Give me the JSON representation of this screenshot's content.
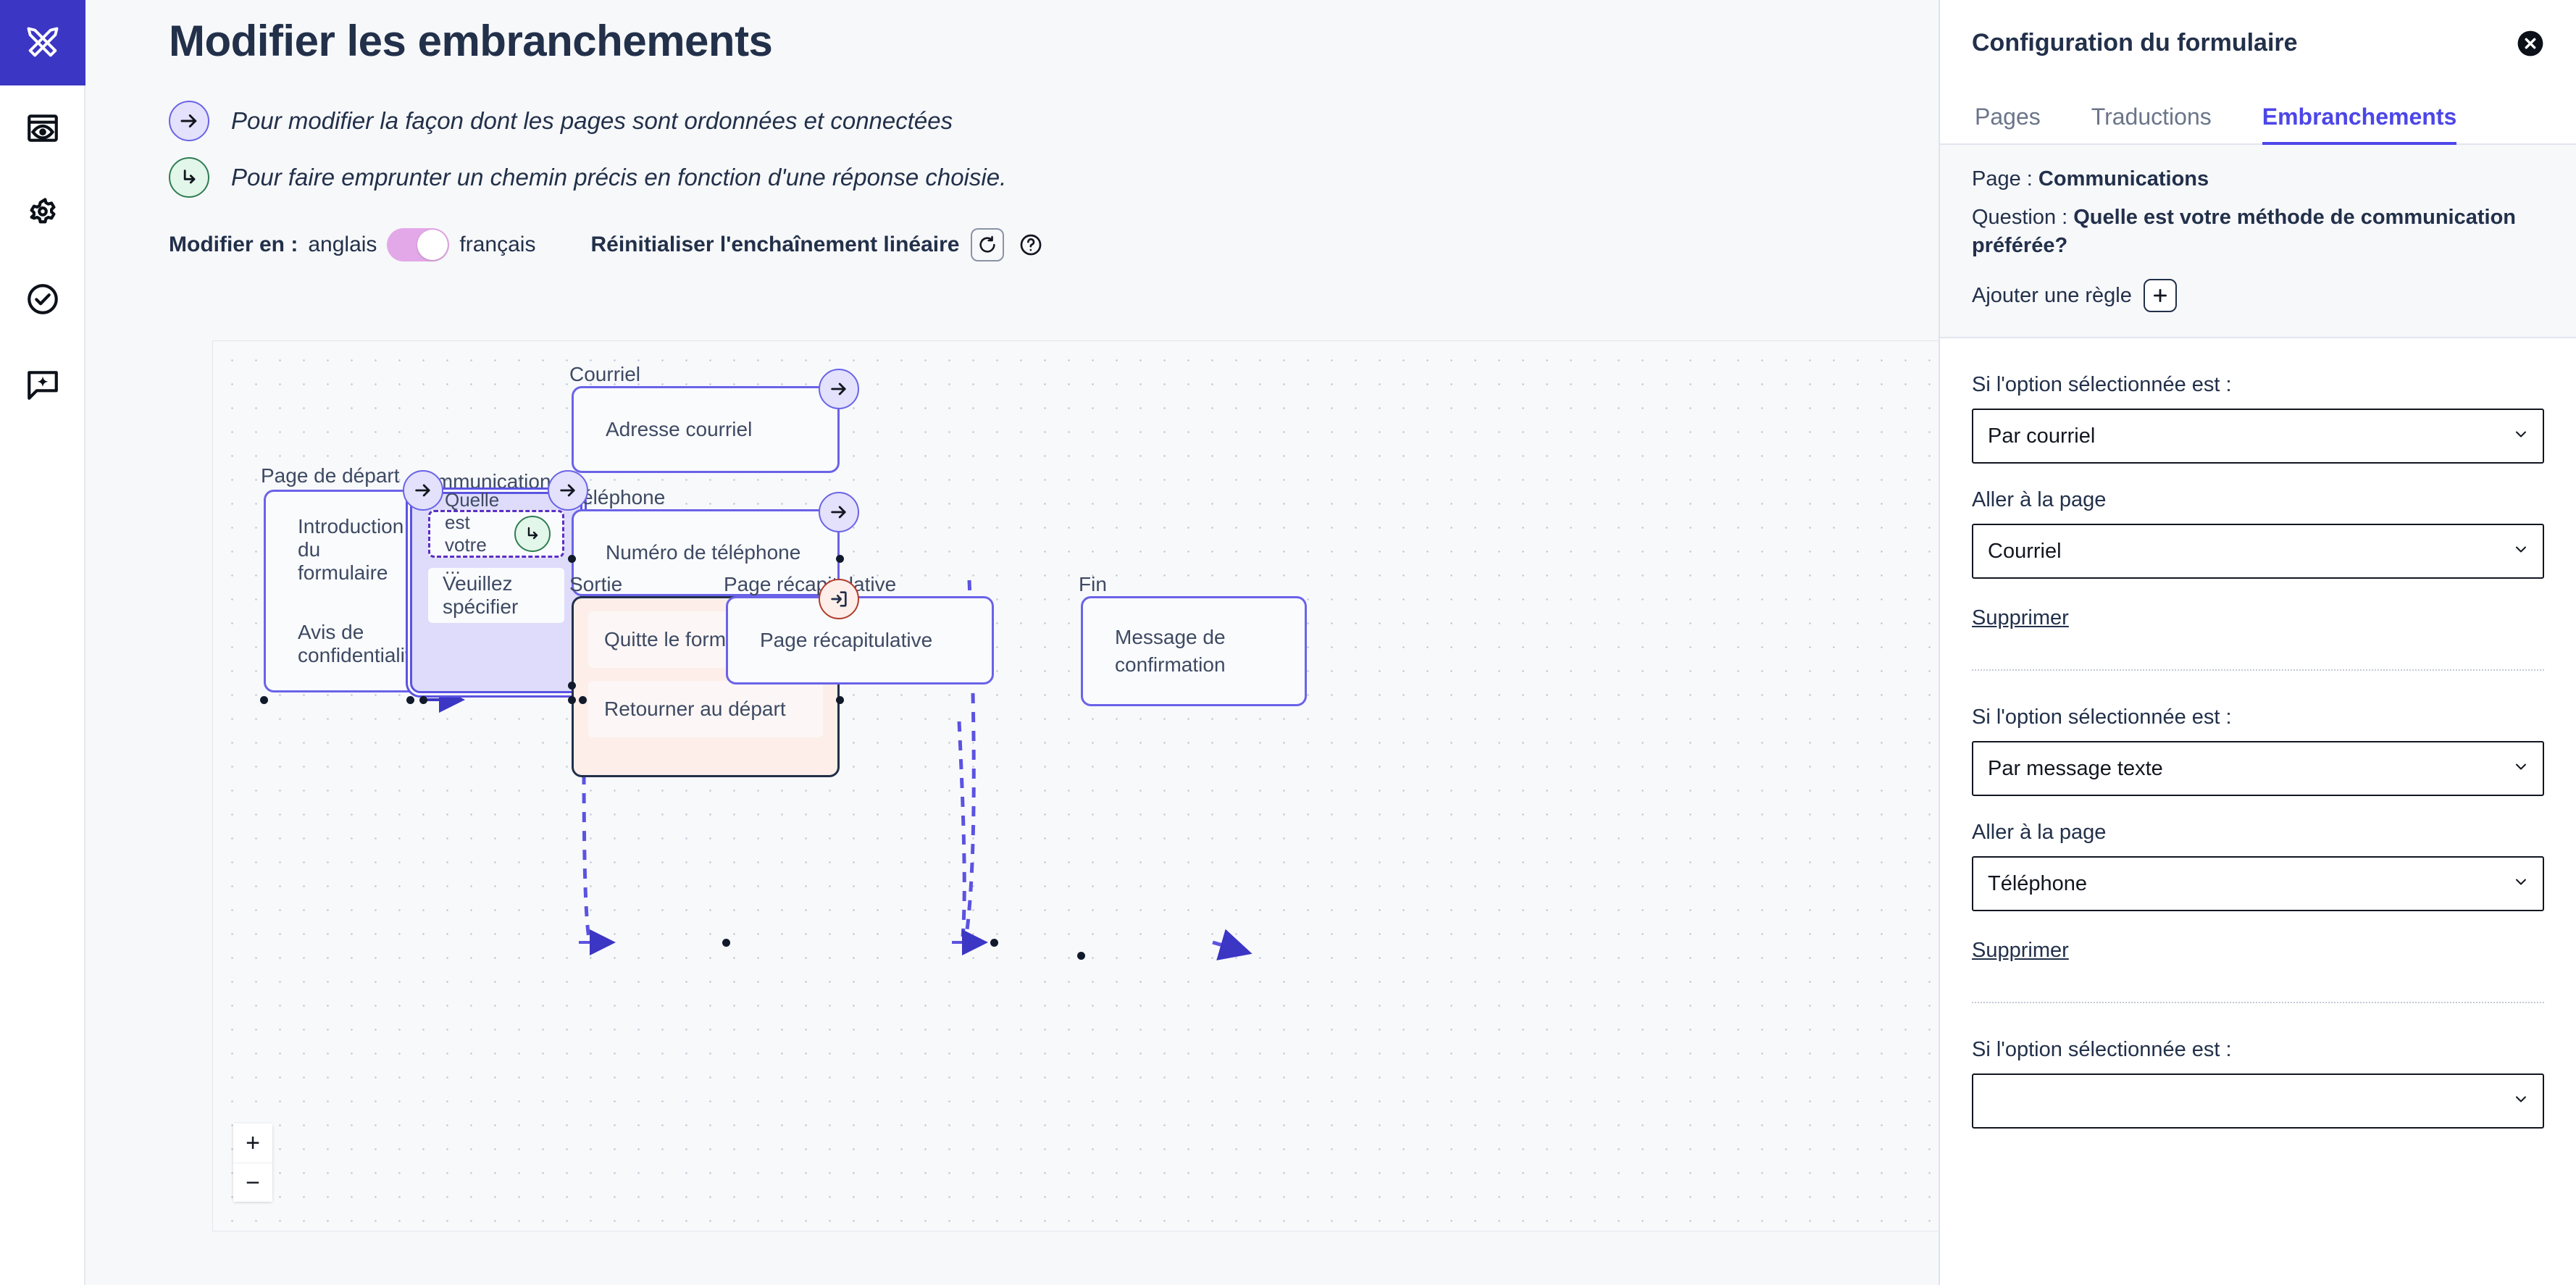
{
  "rail": {
    "items": [
      {
        "name": "design-tools-icon",
        "label": "Conception",
        "active": true
      },
      {
        "name": "preview-icon",
        "label": "Aperçu",
        "active": false
      },
      {
        "name": "gear-icon",
        "label": "Paramètres",
        "active": false
      },
      {
        "name": "check-circle-icon",
        "label": "Validation",
        "active": false
      },
      {
        "name": "feedback-sparkle-icon",
        "label": "Commentaires",
        "active": false
      }
    ]
  },
  "header": {
    "title": "Modifier les embranchements",
    "legend": [
      {
        "icon": "arrow-right-icon",
        "text": "Pour modifier la façon dont les pages sont ordonnées et connectées"
      },
      {
        "icon": "branch-arrow-icon",
        "text": "Pour faire emprunter un chemin précis en fonction d'une réponse choisie."
      }
    ],
    "controls": {
      "edit_in_label": "Modifier en :",
      "lang_left": "anglais",
      "lang_right": "français",
      "toggle_state": "français",
      "reset_label": "Réinitialiser l'enchaînement linéaire",
      "reset_icon": "reset-arrow-icon",
      "help_icon": "question-circle-icon"
    }
  },
  "canvas": {
    "zoom_in_label": "+",
    "zoom_out_label": "−",
    "nodes": [
      {
        "id": "start",
        "label": "Page de départ",
        "rows": [
          "Introduction du formulaire",
          "Avis de confidentialité"
        ]
      },
      {
        "id": "comm",
        "label": "Communications",
        "question": "Quelle est votre ...",
        "rows": [
          "Veuillez spécifier"
        ],
        "selected": true
      },
      {
        "id": "courriel",
        "label": "Courriel",
        "rows": [
          "Adresse courriel"
        ]
      },
      {
        "id": "tel",
        "label": "Téléphone",
        "rows": [
          "Numéro de téléphone"
        ]
      },
      {
        "id": "sortie",
        "label": "Sortie",
        "rows": [
          "Quitte le formulaire",
          "Retourner au départ"
        ],
        "exit": true
      },
      {
        "id": "recap",
        "label": "Page récapitulative",
        "rows": [
          "Page récapitulative"
        ]
      },
      {
        "id": "fin",
        "label": "Fin",
        "rows": [
          "Message de confirmation"
        ]
      }
    ]
  },
  "panel": {
    "title": "Configuration du formulaire",
    "close_icon": "close-icon",
    "tabs": [
      {
        "label": "Pages",
        "active": false
      },
      {
        "label": "Traductions",
        "active": false
      },
      {
        "label": "Embranchements",
        "active": true
      }
    ],
    "context": {
      "page_prefix": "Page : ",
      "page_value": "Communications",
      "question_prefix": "Question : ",
      "question_value": "Quelle est votre méthode de communication préférée?",
      "add_rule_label": "Ajouter une règle",
      "add_rule_icon": "plus-icon"
    },
    "rules": [
      {
        "condition_label": "Si l'option sélectionnée est :",
        "condition_value": "Par courriel",
        "target_label": "Aller à la page",
        "target_value": "Courriel",
        "delete_label": "Supprimer"
      },
      {
        "condition_label": "Si l'option sélectionnée est :",
        "condition_value": "Par message texte",
        "target_label": "Aller à la page",
        "target_value": "Téléphone",
        "delete_label": "Supprimer"
      },
      {
        "condition_label": "Si l'option sélectionnée est :",
        "condition_value": "",
        "target_label": "",
        "target_value": "",
        "delete_label": ""
      }
    ]
  },
  "colors": {
    "brand": "#3c36c4",
    "accent": "#6a63e8",
    "tab_active": "#4c46e8",
    "node_selected_bg": "#dedcfa",
    "exit_bg": "#fdeee9",
    "exit_border": "#22304a",
    "exit_badge_border": "#b23b2e",
    "toggle_on": "#e3a8e8",
    "text": "#22304a"
  }
}
